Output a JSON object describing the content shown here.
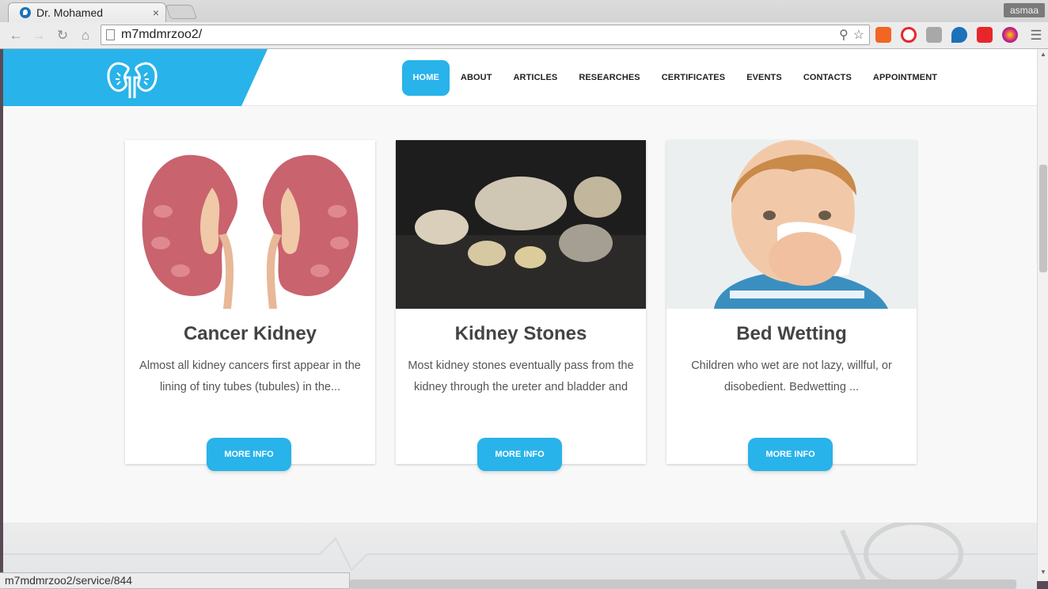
{
  "browser": {
    "tab_title": "Dr. Mohamed",
    "tab_close": "×",
    "profile_name": "asmaa",
    "url": "m7mdmrzoo2/",
    "status_url": "m7mdmrzoo2/service/844"
  },
  "site": {
    "accent_color": "#28b3ea",
    "nav": [
      "HOME",
      "ABOUT",
      "ARTICLES",
      "RESEARCHES",
      "CERTIFICATES",
      "EVENTS",
      "CONTACTS",
      "APPOINTMENT"
    ],
    "active_nav": "HOME"
  },
  "cards": [
    {
      "title": "Cancer Kidney",
      "text": "Almost all kidney cancers first appear in the lining of tiny tubes (tubules) in the...",
      "button": "MORE INFO",
      "image": "kidney-anatomy-illustration"
    },
    {
      "title": "Kidney Stones",
      "text": "Most kidney stones eventually pass from the kidney through the ureter and bladder and",
      "button": "MORE INFO",
      "image": "kidney-stones-photo"
    },
    {
      "title": "Bed Wetting",
      "text": "Children who wet are not lazy, willful, or disobedient. Bedwetting ...",
      "button": "MORE INFO",
      "image": "child-with-tissue-photo"
    }
  ]
}
